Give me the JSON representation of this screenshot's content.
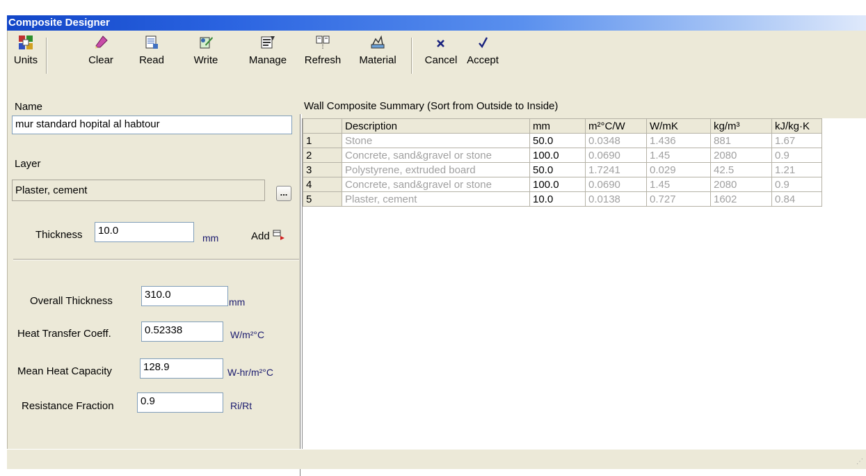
{
  "window": {
    "title": "Composite Designer"
  },
  "toolbar": {
    "units": "Units",
    "clear": "Clear",
    "read": "Read",
    "write": "Write",
    "manage": "Manage",
    "refresh": "Refresh",
    "material": "Material",
    "cancel": "Cancel",
    "accept": "Accept"
  },
  "left": {
    "name_label": "Name",
    "name_value": "mur standard hopital al habtour",
    "layer_label": "Layer",
    "layer_value": "Plaster, cement",
    "browse_label": "...",
    "thickness_label": "Thickness",
    "thickness_value": "10.0",
    "thickness_unit": "mm",
    "add_label": "Add",
    "overall_label": "Overall Thickness",
    "overall_value": "310.0",
    "overall_unit": "mm",
    "htc_label": "Heat Transfer Coeff.",
    "htc_value": "0.52338",
    "htc_unit": "W/m²°C",
    "mhc_label": "Mean Heat Capacity",
    "mhc_value": "128.9",
    "mhc_unit": "W-hr/m²°C",
    "rf_label": "Resistance Fraction",
    "rf_value": "0.9",
    "rf_unit": "Ri/Rt"
  },
  "grid": {
    "title": "Wall Composite Summary (Sort from Outside to Inside)",
    "headers": [
      "",
      "Description",
      "mm",
      "m²°C/W",
      "W/mK",
      "kg/m³",
      "kJ/kg·K"
    ],
    "rows": [
      [
        "1",
        "Stone",
        "50.0",
        "0.0348",
        "1.436",
        "881",
        "1.67"
      ],
      [
        "2",
        "Concrete, sand&gravel or stone",
        "100.0",
        "0.0690",
        "1.45",
        "2080",
        "0.9"
      ],
      [
        "3",
        "Polystyrene, extruded board",
        "50.0",
        "1.7241",
        "0.029",
        "42.5",
        "1.21"
      ],
      [
        "4",
        "Concrete, sand&gravel or stone",
        "100.0",
        "0.0690",
        "1.45",
        "2080",
        "0.9"
      ],
      [
        "5",
        "Plaster, cement",
        "10.0",
        "0.0138",
        "0.727",
        "1602",
        "0.84"
      ]
    ]
  },
  "colors": {
    "title_bar": "#1246c8",
    "face": "#ece9d8",
    "grid_dim_text": "#a0a0a0"
  }
}
